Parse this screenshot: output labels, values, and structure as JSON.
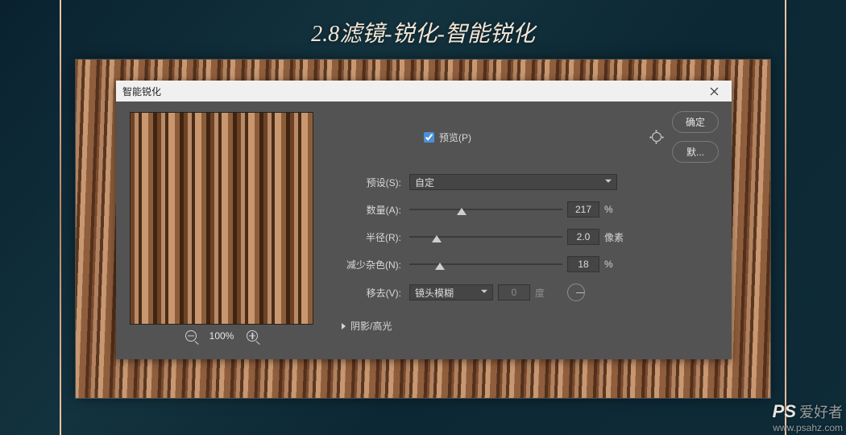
{
  "page_title": "2.8滤镜-锐化-智能锐化",
  "dialog": {
    "title": "智能锐化",
    "preview_checkbox_label": "预览(P)",
    "preview_checked": true,
    "ok_button": "确定",
    "cancel_button": "默...",
    "preset_label": "预设(S):",
    "preset_value": "自定",
    "amount_label": "数量(A):",
    "amount_value": "217",
    "amount_unit": "%",
    "amount_thumb_pct": 34,
    "radius_label": "半径(R):",
    "radius_value": "2.0",
    "radius_unit": "像素",
    "radius_thumb_pct": 18,
    "noise_label": "减少杂色(N):",
    "noise_value": "18",
    "noise_unit": "%",
    "noise_thumb_pct": 20,
    "remove_label": "移去(V):",
    "remove_value": "镜头模糊",
    "angle_value": "0",
    "angle_unit": "度",
    "expander_label": "阴影/高光",
    "zoom_value": "100%"
  },
  "watermark": {
    "logo": "PS",
    "cn": "爱好者",
    "url": "www.psahz.com"
  }
}
